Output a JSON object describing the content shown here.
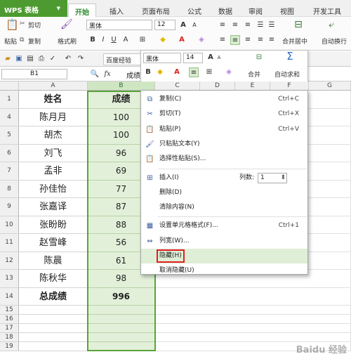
{
  "app": {
    "name": "WPS 表格"
  },
  "tabs": [
    "开始",
    "插入",
    "页面布局",
    "公式",
    "数据",
    "审阅",
    "视图",
    "开发工具"
  ],
  "ribbon": {
    "cut": "剪切",
    "paste": "粘贴",
    "copy": "复制",
    "format_painter": "格式刷",
    "font_name": "黑体",
    "font_size": "12",
    "merge_center": "合并居中",
    "auto_wrap": "自动换行"
  },
  "qat": {
    "tab_doc": "百度经验"
  },
  "mini_toolbar": {
    "font": "黑体",
    "size": "14",
    "merge": "合并",
    "autosum": "自动求和"
  },
  "formula_bar": {
    "name_box": "B1",
    "fx": "fx",
    "content": "成绩"
  },
  "columns": [
    "A",
    "B",
    "C",
    "D",
    "E",
    "F",
    "G"
  ],
  "rows": [
    {
      "num": "1",
      "name": "姓名",
      "score": "成绩",
      "header": true
    },
    {
      "num": "4",
      "name": "陈月月",
      "score": "100"
    },
    {
      "num": "5",
      "name": "胡杰",
      "score": "100"
    },
    {
      "num": "6",
      "name": "刘飞",
      "score": "96"
    },
    {
      "num": "7",
      "name": "孟非",
      "score": "69"
    },
    {
      "num": "8",
      "name": "孙佳怡",
      "score": "77"
    },
    {
      "num": "9",
      "name": "张嘉译",
      "score": "87"
    },
    {
      "num": "10",
      "name": "张盼盼",
      "score": "88"
    },
    {
      "num": "11",
      "name": "赵雪峰",
      "score": "56"
    },
    {
      "num": "12",
      "name": "陈晨",
      "score": "61"
    },
    {
      "num": "13",
      "name": "陈秋华",
      "score": "98"
    },
    {
      "num": "14",
      "name": "总成绩",
      "score": "996",
      "total": true
    },
    {
      "num": "15",
      "name": "",
      "score": ""
    },
    {
      "num": "16",
      "name": "",
      "score": ""
    },
    {
      "num": "17",
      "name": "",
      "score": ""
    },
    {
      "num": "18",
      "name": "",
      "score": ""
    },
    {
      "num": "19",
      "name": "",
      "score": ""
    }
  ],
  "context_menu": [
    {
      "label": "复制(C)",
      "shortcut": "Ctrl+C",
      "icon": "copy-icon",
      "glyph": "⧉"
    },
    {
      "label": "剪切(T)",
      "shortcut": "Ctrl+X",
      "icon": "cut-icon",
      "glyph": "✂"
    },
    {
      "label": "粘贴(P)",
      "shortcut": "Ctrl+V",
      "icon": "paste-icon",
      "glyph": "📋"
    },
    {
      "label": "只粘贴文本(Y)",
      "shortcut": "",
      "icon": "paste-text-icon",
      "glyph": "🖌"
    },
    {
      "label": "选择性粘贴(S)...",
      "shortcut": "",
      "icon": "paste-special-icon",
      "glyph": "📋"
    },
    {
      "sep": true
    },
    {
      "label": "插入(I)",
      "shortcut": "",
      "icon": "insert-icon",
      "glyph": "⊞",
      "extra": {
        "label": "列数:",
        "value": "1"
      }
    },
    {
      "label": "删除(D)",
      "shortcut": "",
      "icon": "",
      "glyph": ""
    },
    {
      "label": "清除内容(N)",
      "shortcut": "",
      "icon": "",
      "glyph": ""
    },
    {
      "sep": true
    },
    {
      "label": "设置单元格格式(F)...",
      "shortcut": "Ctrl+1",
      "icon": "format-cells-icon",
      "glyph": "▦"
    },
    {
      "label": "列宽(W)...",
      "shortcut": "",
      "icon": "column-width-icon",
      "glyph": "⇔"
    },
    {
      "label": "隐藏(H)",
      "shortcut": "",
      "icon": "",
      "glyph": "",
      "highlight": true
    },
    {
      "label": "取消隐藏(U)",
      "shortcut": "",
      "icon": "",
      "glyph": ""
    }
  ],
  "colors": {
    "accent": "#4d9b30",
    "selection": "#e2f0d9",
    "highlight_box": "#e02020"
  },
  "watermark": "Baidu 经验"
}
